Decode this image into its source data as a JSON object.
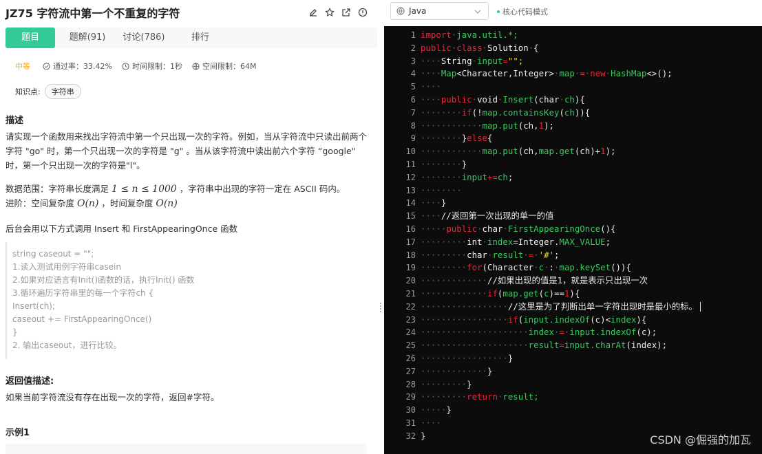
{
  "problem": {
    "title": "JZ75  字符流中第一个不重复的字符",
    "tabs": [
      {
        "label": "题目"
      },
      {
        "label": "题解(91)"
      },
      {
        "label": "讨论(786)"
      },
      {
        "label": "排行"
      }
    ],
    "difficulty": "中等",
    "pass_rate": "通过率：33.42%",
    "time_limit": "时间限制：1秒",
    "space_limit": "空间限制：64M",
    "knowledge_label": "知识点:",
    "knowledge_tag": "字符串",
    "description_heading": "描述",
    "description": "请实现一个函数用来找出字符流中第一个只出现一次的字符。例如，当从字符流中只读出前两个字符 \"go\" 时，第一个只出现一次的字符是 \"g\" 。当从该字符流中读出前六个字符 “google\" 时，第一个只出现一次的字符是\"l\"。",
    "range_prefix": "数据范围：字符串长度满足 ",
    "range_math": "1 ≤ n ≤ 1000",
    "range_suffix": " ，字符串中出现的字符一定在 ASCII 码内。",
    "complexity_prefix": "进阶：空间复杂度 ",
    "complexity_space": "O(n)",
    "complexity_middle": " ，时间复杂度 ",
    "complexity_time": "O(n)",
    "backend_note": "后台会用以下方式调用 Insert 和 FirstAppearingOnce 函数",
    "backend_code": [
      "string caseout = \"\";",
      "1.读入测试用例字符串casein",
      "2.如果对应语言有Init()函数的话，执行Init() 函数",
      "3.循环遍历字符串里的每一个字符ch {",
      "Insert(ch);",
      "caseout += FirstAppearingOnce()",
      "}",
      "2. 输出caseout，进行比较。"
    ],
    "return_heading": "返回值描述:",
    "return_desc": "如果当前字符流没有存在出现一次的字符，返回#字符。",
    "example_heading": "示例1"
  },
  "editor": {
    "language": "Java",
    "mode": "核心代码模式",
    "line_numbers": [
      "1",
      "2",
      "3",
      "4",
      "5",
      "6",
      "7",
      "8",
      "9",
      "10",
      "11",
      "12",
      "13",
      "14",
      "15",
      "16",
      "17",
      "18",
      "19",
      "20",
      "21",
      "22",
      "23",
      "24",
      "25",
      "26",
      "27",
      "28",
      "29",
      "30",
      "31",
      "32"
    ],
    "tokens": {
      "import": "import",
      "java_util": "java.util.*;",
      "public": "public",
      "class": "class",
      "Solution": "Solution",
      "brace_open": "{",
      "String": "String",
      "input": "input",
      "eq_empty": "=",
      "empty_str": "\"\";",
      "Map": "Map",
      "map_generic": "<Character,Integer>",
      "map": "map",
      "eq": "=",
      "new": "new",
      "HashMap": "HashMap",
      "hashmap_tail": "<>();",
      "void": "void",
      "Insert": "Insert",
      "char_ch": "(char",
      "ch_param": "ch",
      "paren_brace": "){",
      "if": "if",
      "line7_a": "(!",
      "line7_b": "map.containsKey",
      "line7_c": "(",
      "line7_d": "ch",
      "line7_e": ")){",
      "line8_a": "map.put",
      "line8_b": "(ch,",
      "line8_c": "1",
      "line8_d": ");",
      "else_close": "}",
      "else": "else",
      "else_open": "{",
      "line10_a": "map.put",
      "line10_b": "(ch,",
      "line10_c": "map.get",
      "line10_d": "(ch)+",
      "line10_e": "1",
      "line10_f": ");",
      "close": "}",
      "line12_a": "input",
      "line12_b": "+=",
      "line12_c": "ch",
      "line12_d": ";",
      "comment15": "//返回第一次出现的单一的值",
      "char": "char",
      "FirstAppearingOnce": "FirstAppearingOnce",
      "fao_tail": "(){",
      "int": "int",
      "index": "index",
      "line17_eq": "=Integer.",
      "MAX_VALUE": "MAX_VALUE",
      "semicolon": ";",
      "result": "result",
      "hash_char": "'#'",
      "for": "for",
      "for_a": "(Character",
      "c": "c",
      "colon": ":",
      "keySet": "map.keySet",
      "for_tail": "()){",
      "comment20": "//如果出现的值是1，就是表示只出现一次",
      "if21_a": "(",
      "if21_b": "map.get",
      "if21_c": "(",
      "if21_d": "c",
      "if21_e": ")==",
      "if21_f": "1",
      "if21_g": "){",
      "comment22": "//这里是为了判断出单一字符出现时是最小的标。",
      "if23_a": "(",
      "if23_b": "input.indexOf",
      "if23_c": "(c)<",
      "if23_d": "index",
      "if23_e": "){",
      "line24_a": "index",
      "line24_b": "=",
      "line24_c": "input.indexOf",
      "line24_d": "(c);",
      "line25_a": "result",
      "line25_b": "=",
      "line25_c": "input.charAt",
      "line25_d": "(index);",
      "return": "return",
      "result_semi": "result;"
    }
  },
  "watermark": "CSDN @倔强的加瓦"
}
